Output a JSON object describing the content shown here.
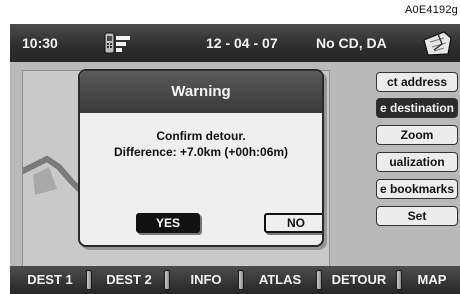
{
  "figure_code": "A0E4192g",
  "status_bar": {
    "time": "10:30",
    "date": "12 - 04 - 07",
    "media": "No CD, DA",
    "phone_icon": "phone-icon",
    "nav_icon": "navigation-map-icon"
  },
  "side_menu": {
    "items": [
      {
        "label": "ct address",
        "active": false
      },
      {
        "label": "e destination",
        "active": true
      },
      {
        "label": "Zoom",
        "active": false
      },
      {
        "label": "ualization",
        "active": false
      },
      {
        "label": "e bookmarks",
        "active": false
      },
      {
        "label": "Set",
        "active": false
      }
    ]
  },
  "dialog": {
    "title": "Warning",
    "line1": "Confirm detour.",
    "line2": "Difference: +7.0km (+00h:06m)",
    "yes_label": "YES",
    "no_label": "NO"
  },
  "bottom_bar": {
    "tabs": [
      "DEST 1",
      "DEST 2",
      "INFO",
      "ATLAS",
      "DETOUR",
      "MAP"
    ]
  },
  "colors": {
    "bar_dark": "#2e2e2e",
    "background": "#b9b9b9",
    "active_item": "#2b2b2b"
  }
}
